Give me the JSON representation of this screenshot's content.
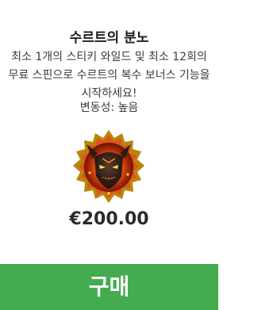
{
  "card": {
    "title": "수르트의 분노",
    "description": "최소 1개의 스티키 와일드 및 최소 12회의 무료 스핀으로 수르트의 복수 보너스 기능을 시작하세요!",
    "volatility": "변동성: 높음",
    "price": "€200.00",
    "buy_label": "구매"
  },
  "art": {
    "icon": "fire-demon-emblem-icon"
  },
  "colors": {
    "buy_button": "#44ab4f",
    "background": "#ffffff",
    "title_text": "#1e1e1e"
  }
}
